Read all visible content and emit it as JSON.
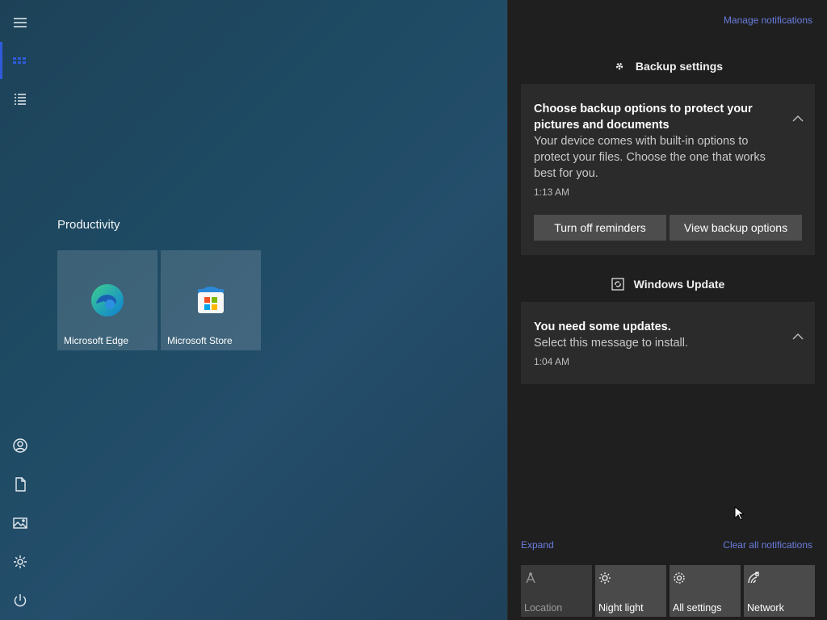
{
  "start": {
    "group_title": "Productivity",
    "tiles": [
      {
        "label": "Microsoft Edge",
        "icon": "edge-icon"
      },
      {
        "label": "Microsoft Store",
        "icon": "store-icon"
      }
    ],
    "rail_icons": [
      "hamburger-icon",
      "tiles-icon",
      "all-apps-list-icon",
      "user-icon",
      "documents-icon",
      "pictures-icon",
      "settings-icon",
      "power-icon"
    ]
  },
  "action_center": {
    "manage_link": "Manage notifications",
    "groups": [
      {
        "app": "Backup settings",
        "icon": "gear-icon",
        "title": "Choose backup options to protect your pictures and documents",
        "body": "Your device comes with built-in options to protect your files. Choose the one that works best for you.",
        "time": "1:13 AM",
        "buttons": [
          "Turn off reminders",
          "View backup options"
        ]
      },
      {
        "app": "Windows Update",
        "icon": "update-icon",
        "title": "You need some updates.",
        "body": "Select this message to install.",
        "time": "1:04 AM"
      }
    ],
    "expand_link": "Expand",
    "clear_link": "Clear all notifications",
    "quick_actions": [
      {
        "label": "Location",
        "icon": "location-icon",
        "enabled": false
      },
      {
        "label": "Night light",
        "icon": "night-light-icon",
        "enabled": true
      },
      {
        "label": "All settings",
        "icon": "gear-icon",
        "enabled": true
      },
      {
        "label": "Network",
        "icon": "network-icon",
        "enabled": true
      }
    ]
  },
  "colors": {
    "accent": "#2f5bd8",
    "link": "#6a7de0",
    "panel": "#1f1f1f",
    "card": "#2b2b2b"
  }
}
